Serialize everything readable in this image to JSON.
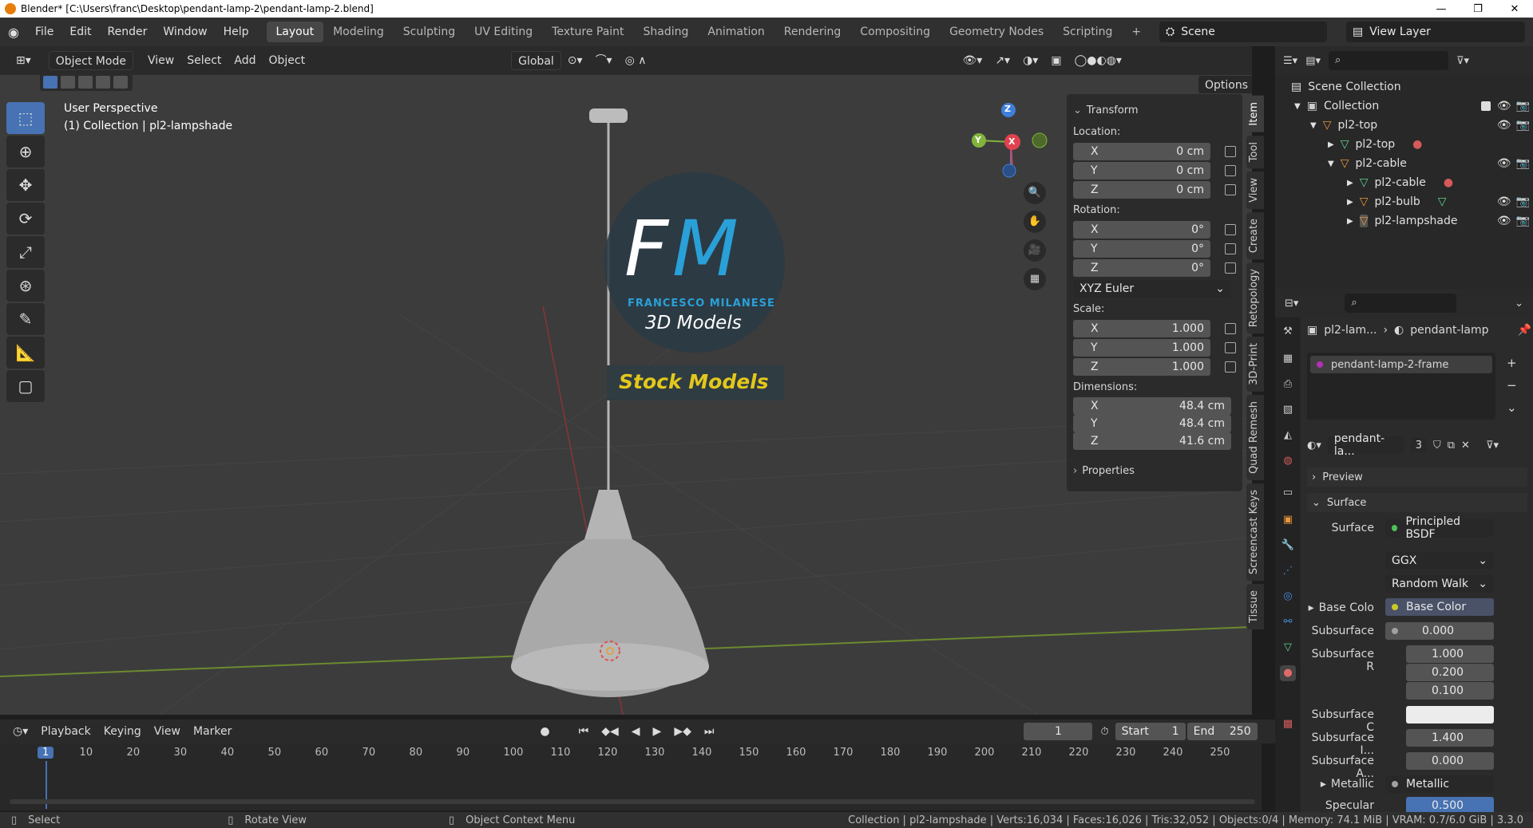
{
  "window": {
    "title": "Blender* [C:\\Users\\franc\\Desktop\\pendant-lamp-2\\pendant-lamp-2.blend]",
    "controls": [
      "—",
      "❐",
      "✕"
    ]
  },
  "menus": [
    "File",
    "Edit",
    "Render",
    "Window",
    "Help"
  ],
  "workspaces": [
    "Layout",
    "Modeling",
    "Sculpting",
    "UV Editing",
    "Texture Paint",
    "Shading",
    "Animation",
    "Rendering",
    "Compositing",
    "Geometry Nodes",
    "Scripting"
  ],
  "workspace_add": "+",
  "scene_name": "Scene",
  "view_layer": "View Layer",
  "header": {
    "mode": "Object Mode",
    "menus": [
      "View",
      "Select",
      "Add",
      "Object"
    ],
    "orientation": "Global",
    "options": "Options"
  },
  "viewport": {
    "perspective": "User Perspective",
    "collection_info": "(1) Collection | pl2-lampshade"
  },
  "watermark": {
    "initials_f": "F",
    "initials_m": "M",
    "name": "FRANCESCO MILANESE",
    "tagline": "3D Models",
    "banner": "Stock Models"
  },
  "gizmo": {
    "x": "X",
    "y": "Y",
    "z": "Z"
  },
  "npanel": {
    "tabs": [
      "Item",
      "Tool",
      "View",
      "Create",
      "Retopology",
      "3D-Print",
      "Quad Remesh",
      "Screencast Keys",
      "Tissue"
    ],
    "transform_title": "Transform",
    "location_label": "Location:",
    "location": [
      {
        "axis": "X",
        "value": "0 cm"
      },
      {
        "axis": "Y",
        "value": "0 cm"
      },
      {
        "axis": "Z",
        "value": "0 cm"
      }
    ],
    "rotation_label": "Rotation:",
    "rotation": [
      {
        "axis": "X",
        "value": "0°"
      },
      {
        "axis": "Y",
        "value": "0°"
      },
      {
        "axis": "Z",
        "value": "0°"
      }
    ],
    "rotation_mode": "XYZ Euler",
    "scale_label": "Scale:",
    "scale": [
      {
        "axis": "X",
        "value": "1.000"
      },
      {
        "axis": "Y",
        "value": "1.000"
      },
      {
        "axis": "Z",
        "value": "1.000"
      }
    ],
    "dimensions_label": "Dimensions:",
    "dimensions": [
      {
        "axis": "X",
        "value": "48.4 cm"
      },
      {
        "axis": "Y",
        "value": "48.4 cm"
      },
      {
        "axis": "Z",
        "value": "41.6 cm"
      }
    ],
    "properties_title": "Properties"
  },
  "outliner": {
    "root": "Scene Collection",
    "items": [
      {
        "label": "Collection",
        "icon": "collection-icon"
      },
      {
        "label": "pl2-top",
        "icon": "object-icon"
      },
      {
        "label": "pl2-top",
        "icon": "mesh-icon"
      },
      {
        "label": "pl2-cable",
        "icon": "object-icon"
      },
      {
        "label": "pl2-cable",
        "icon": "mesh-icon"
      },
      {
        "label": "pl2-bulb",
        "icon": "object-icon"
      },
      {
        "label": "pl2-lampshade",
        "icon": "object-icon"
      }
    ]
  },
  "properties": {
    "breadcrumb_object": "pl2-lam...",
    "breadcrumb_material": "pendant-lamp",
    "material_slot": "pendant-lamp-2-frame",
    "material_name": "pendant-la...",
    "material_users": "3",
    "preview": "Preview",
    "surface_section": "Surface",
    "surface_label": "Surface",
    "surface_value": "Principled BSDF",
    "distribution": "GGX",
    "subsurface_method": "Random Walk",
    "rows": [
      {
        "label": "Base Colo",
        "value": "Base Color"
      },
      {
        "label": "Subsurface",
        "value": "0.000"
      },
      {
        "label": "Subsurface R",
        "value": "1.000"
      },
      {
        "label": "",
        "value": "0.200"
      },
      {
        "label": "",
        "value": "0.100"
      },
      {
        "label": "Subsurface C",
        "value": ""
      },
      {
        "label": "Subsurface I...",
        "value": "1.400"
      },
      {
        "label": "Subsurface A...",
        "value": "0.000"
      },
      {
        "label": "Metallic",
        "value": "Metallic"
      },
      {
        "label": "Specular",
        "value": "0.500"
      }
    ]
  },
  "timeline": {
    "menus": [
      "Playback",
      "Keying",
      "View",
      "Marker"
    ],
    "current_frame": "1",
    "start_label": "Start",
    "start": "1",
    "end_label": "End",
    "end": "250",
    "ticks": [
      "1",
      "10",
      "20",
      "30",
      "40",
      "50",
      "60",
      "70",
      "80",
      "90",
      "100",
      "110",
      "120",
      "130",
      "140",
      "150",
      "160",
      "170",
      "180",
      "190",
      "200",
      "210",
      "220",
      "230",
      "240",
      "250"
    ]
  },
  "status": {
    "select": "Select",
    "rotate": "Rotate View",
    "context": "Object Context Menu",
    "stats": "Collection | pl2-lampshade | Verts:16,034 | Faces:16,026 | Tris:32,052 | Objects:0/4 | Memory: 74.1 MiB | VRAM: 0.7/6.0 GiB | 3.3.0"
  },
  "colors": {
    "accent": "#4772b3",
    "x_axis": "#e0414f",
    "y_axis": "#82b43c",
    "z_axis": "#3f7fdb",
    "watermark_banner": "#e3c81b"
  }
}
